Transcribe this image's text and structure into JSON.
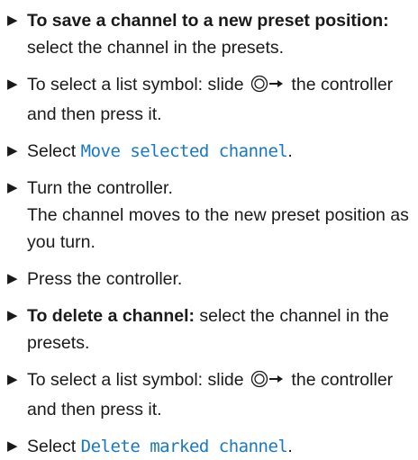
{
  "colors": {
    "text": "#1a1a1a",
    "display_text": "#1a78c2"
  },
  "steps": [
    {
      "lead": "To save a channel to a new preset posi­tion:",
      "text": " select the channel in the presets."
    },
    {
      "pre": "To select a list symbol: slide ",
      "post": " the con­troller and then press it."
    },
    {
      "pre": "Select ",
      "display": "Move selected channel",
      "post": "."
    },
    {
      "text": "Turn the controller.",
      "line2": "The channel moves to the new preset posi­tion as you turn."
    },
    {
      "text": "Press the controller."
    },
    {
      "lead": "To delete a channel:",
      "text": " select the channel in the presets."
    },
    {
      "pre": "To select a list symbol: slide ",
      "post": " the con­troller and then press it."
    },
    {
      "pre": "Select ",
      "display": "Delete marked channel",
      "post": "."
    }
  ],
  "icons": {
    "bullet": "triangle-right",
    "controller_slide": "controller-slide-right"
  }
}
